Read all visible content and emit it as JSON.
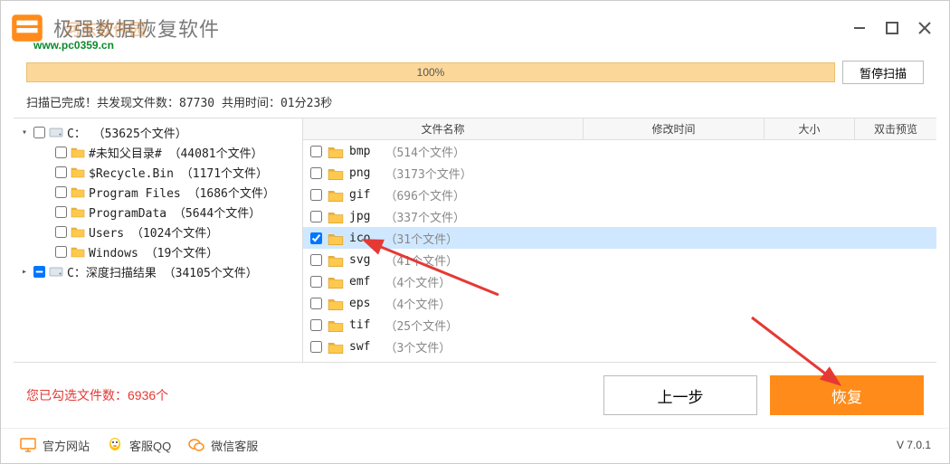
{
  "header": {
    "title": "极强数据恢复软件",
    "watermark_site": "www.pc0359.cn",
    "watermark_cn": "河东软件园"
  },
  "progress": {
    "percent": "100%",
    "pause_label": "暂停扫描"
  },
  "status": {
    "text": "扫描已完成！共发现文件数：87730   共用时间：01分23秒"
  },
  "tree": {
    "items": [
      {
        "indent": 0,
        "toggle": "▾",
        "checked": false,
        "icon": "drive",
        "label": "C：  （53625个文件）"
      },
      {
        "indent": 1,
        "toggle": "",
        "checked": false,
        "icon": "folder",
        "label": "#未知父目录#  （44081个文件）"
      },
      {
        "indent": 1,
        "toggle": "",
        "checked": false,
        "icon": "folder",
        "label": "$Recycle.Bin  （1171个文件）"
      },
      {
        "indent": 1,
        "toggle": "",
        "checked": false,
        "icon": "folder",
        "label": "Program Files  （1686个文件）"
      },
      {
        "indent": 1,
        "toggle": "",
        "checked": false,
        "icon": "folder",
        "label": "ProgramData  （5644个文件）"
      },
      {
        "indent": 1,
        "toggle": "",
        "checked": false,
        "icon": "folder",
        "label": "Users  （1024个文件）"
      },
      {
        "indent": 1,
        "toggle": "",
        "checked": false,
        "icon": "folder",
        "label": "Windows  （19个文件）"
      },
      {
        "indent": 0,
        "toggle": "▸",
        "checked": "mixed",
        "icon": "drive",
        "label": "C：深度扫描结果  （34105个文件）"
      }
    ]
  },
  "list": {
    "headers": {
      "name": "文件名称",
      "time": "修改时间",
      "size": "大小",
      "preview": "双击预览"
    },
    "rows": [
      {
        "checked": false,
        "name": "bmp",
        "count": "（514个文件）",
        "selected": false
      },
      {
        "checked": false,
        "name": "png",
        "count": "（3173个文件）",
        "selected": false
      },
      {
        "checked": false,
        "name": "gif",
        "count": "（696个文件）",
        "selected": false
      },
      {
        "checked": false,
        "name": "jpg",
        "count": "（337个文件）",
        "selected": false
      },
      {
        "checked": true,
        "name": "ico",
        "count": "（31个文件）",
        "selected": true
      },
      {
        "checked": false,
        "name": "svg",
        "count": "（41个文件）",
        "selected": false
      },
      {
        "checked": false,
        "name": "emf",
        "count": "（4个文件）",
        "selected": false
      },
      {
        "checked": false,
        "name": "eps",
        "count": "（4个文件）",
        "selected": false
      },
      {
        "checked": false,
        "name": "tif",
        "count": "（25个文件）",
        "selected": false
      },
      {
        "checked": false,
        "name": "swf",
        "count": "（3个文件）",
        "selected": false
      }
    ]
  },
  "footer": {
    "selected_text": "您已勾选文件数：6936个",
    "prev_label": "上一步",
    "recover_label": "恢复"
  },
  "bottom": {
    "site_label": "官方网站",
    "qq_label": "客服QQ",
    "wechat_label": "微信客服",
    "version": "V 7.0.1"
  }
}
